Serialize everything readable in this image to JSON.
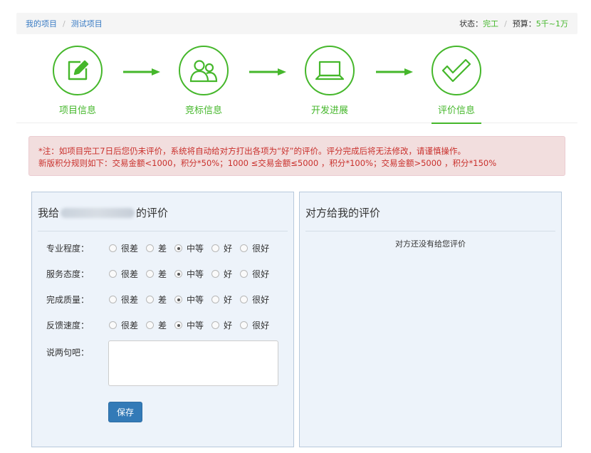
{
  "breadcrumb": {
    "items": [
      "我的项目",
      "测试项目"
    ]
  },
  "status": {
    "state_label": "状态：",
    "state_value": "完工",
    "budget_label": "预算：",
    "budget_value": "5千~1万"
  },
  "steps": [
    {
      "label": "项目信息",
      "icon": "edit-icon"
    },
    {
      "label": "竞标信息",
      "icon": "users-icon"
    },
    {
      "label": "开发进展",
      "icon": "laptop-icon"
    },
    {
      "label": "评价信息",
      "icon": "check-icon",
      "active": true
    }
  ],
  "notice": {
    "line1": "*注：如项目完工7日后您仍未评价，系统将自动给对方打出各项为“好”的评价。评分完成后将无法修改，请谨慎操作。",
    "line2": "新版积分规则如下：交易金额<1000，积分*50%；1000 ≤交易金额≤5000 ，积分*100%；交易金额>5000 ，积分*150%"
  },
  "my_review": {
    "title_prefix": "我给",
    "title_suffix": "的评价",
    "options": [
      "很差",
      "差",
      "中等",
      "好",
      "很好"
    ],
    "criteria": [
      {
        "label": "专业程度：",
        "selected": "中等"
      },
      {
        "label": "服务态度：",
        "selected": "中等"
      },
      {
        "label": "完成质量：",
        "selected": "中等"
      },
      {
        "label": "反馈速度：",
        "selected": "中等"
      }
    ],
    "comment_label": "说两句吧：",
    "comment_value": "",
    "save_label": "保存"
  },
  "their_review": {
    "title": "对方给我的评价",
    "empty_message": "对方还没有给您评价"
  },
  "colors": {
    "accent_green": "#45b72b",
    "link_blue": "#3a7cc4",
    "button_blue": "#337ab7",
    "alert_text": "#c9302c"
  }
}
